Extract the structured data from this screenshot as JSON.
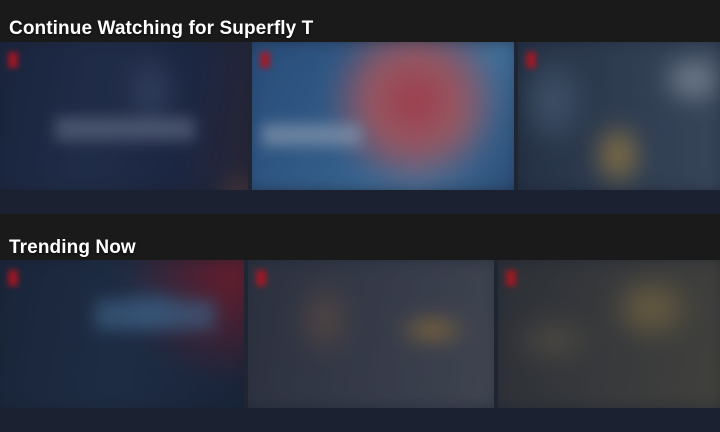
{
  "rows": [
    {
      "title": "Continue Watching for Superfly T",
      "tiles": [
        {
          "name": "title-tile-1"
        },
        {
          "name": "title-tile-2"
        },
        {
          "name": "title-tile-3"
        }
      ]
    },
    {
      "title": "Trending Now",
      "tiles": [
        {
          "name": "title-tile-1"
        },
        {
          "name": "title-tile-2"
        },
        {
          "name": "title-tile-3"
        }
      ]
    }
  ],
  "colors": {
    "background": "#1a1a1a",
    "rail": "#1f2533",
    "accent": "#b01420",
    "text": "#ffffff"
  }
}
